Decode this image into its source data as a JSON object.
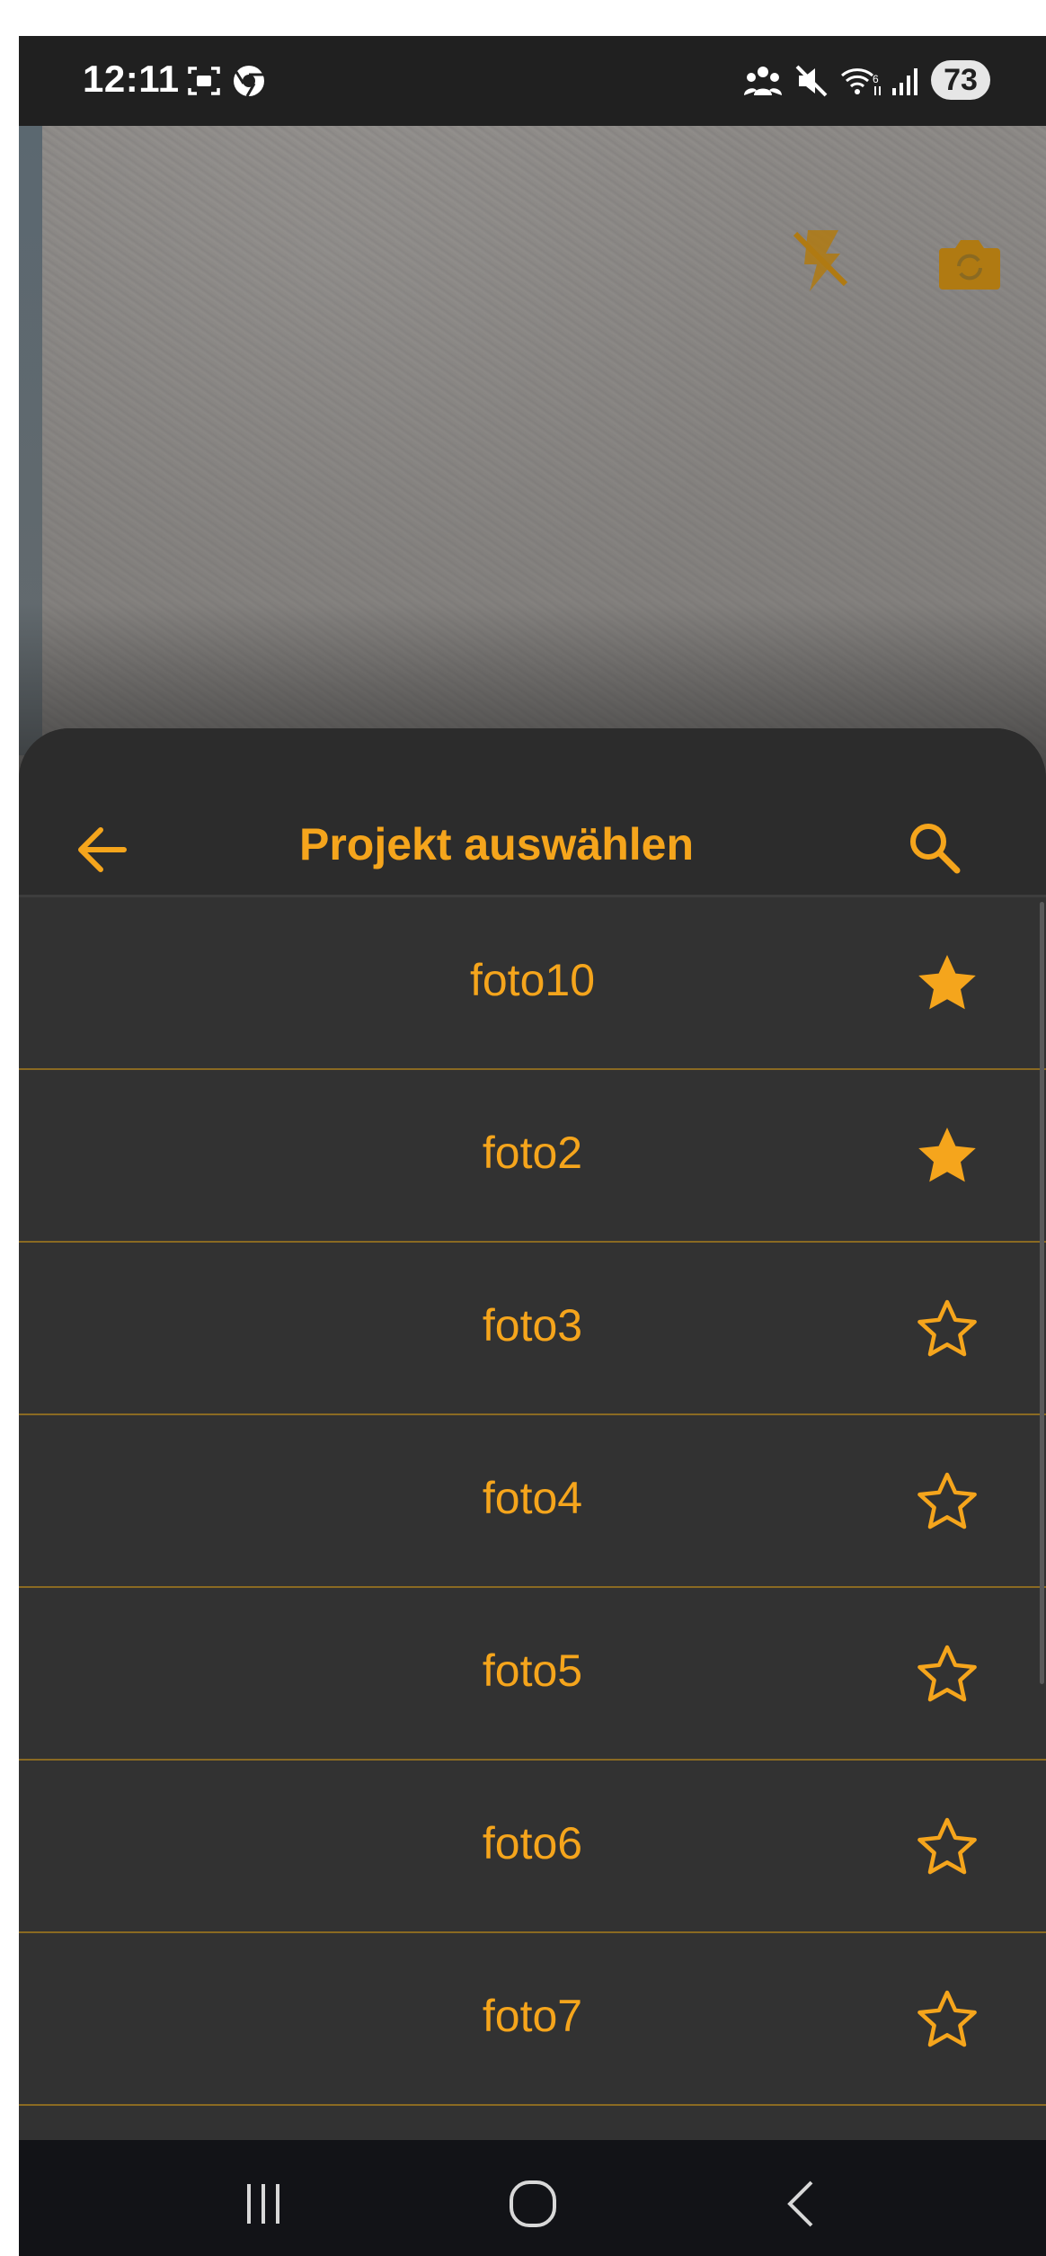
{
  "status_bar": {
    "time": "12:11",
    "battery": "73"
  },
  "sheet": {
    "title": "Projekt auswählen",
    "items": [
      {
        "label": "foto10",
        "favorite": true
      },
      {
        "label": "foto2",
        "favorite": true
      },
      {
        "label": "foto3",
        "favorite": false
      },
      {
        "label": "foto4",
        "favorite": false
      },
      {
        "label": "foto5",
        "favorite": false
      },
      {
        "label": "foto6",
        "favorite": false
      },
      {
        "label": "foto7",
        "favorite": false
      }
    ]
  },
  "icons": {
    "back": "arrow-left-icon",
    "search": "search-icon",
    "favorite_on": "star-filled-icon",
    "favorite_off": "star-outline-icon",
    "flash": "flash-off-icon",
    "camera_switch": "camera-switch-icon"
  },
  "colors": {
    "accent": "#f5a51c",
    "sheet_background": "#323232",
    "divider": "#8a6a22",
    "nav_background": "#121317"
  }
}
